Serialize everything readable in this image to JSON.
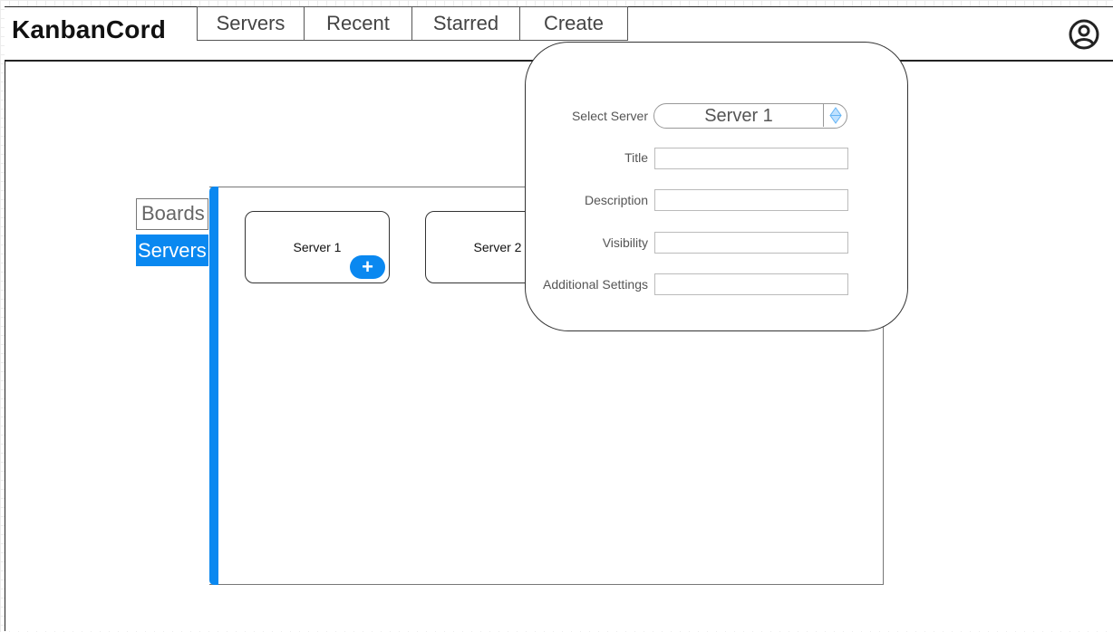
{
  "app": {
    "title": "KanbanCord"
  },
  "nav": {
    "tabs": [
      {
        "label": "Servers"
      },
      {
        "label": "Recent"
      },
      {
        "label": "Starred"
      },
      {
        "label": "Create"
      }
    ]
  },
  "sidebar": {
    "boards_label": "Boards",
    "servers_label": "Servers"
  },
  "board": {
    "servers": [
      {
        "name": "Server 1",
        "add_label": "+"
      },
      {
        "name": "Server 2"
      }
    ]
  },
  "create_form": {
    "select_server_label": "Select Server",
    "select_server_value": "Server 1",
    "title_label": "Title",
    "description_label": "Description",
    "visibility_label": "Visibility",
    "additional_settings_label": "Additional Settings",
    "title_value": "",
    "description_value": "",
    "visibility_value": "",
    "additional_settings_value": ""
  },
  "colors": {
    "accent": "#0a88f0"
  }
}
